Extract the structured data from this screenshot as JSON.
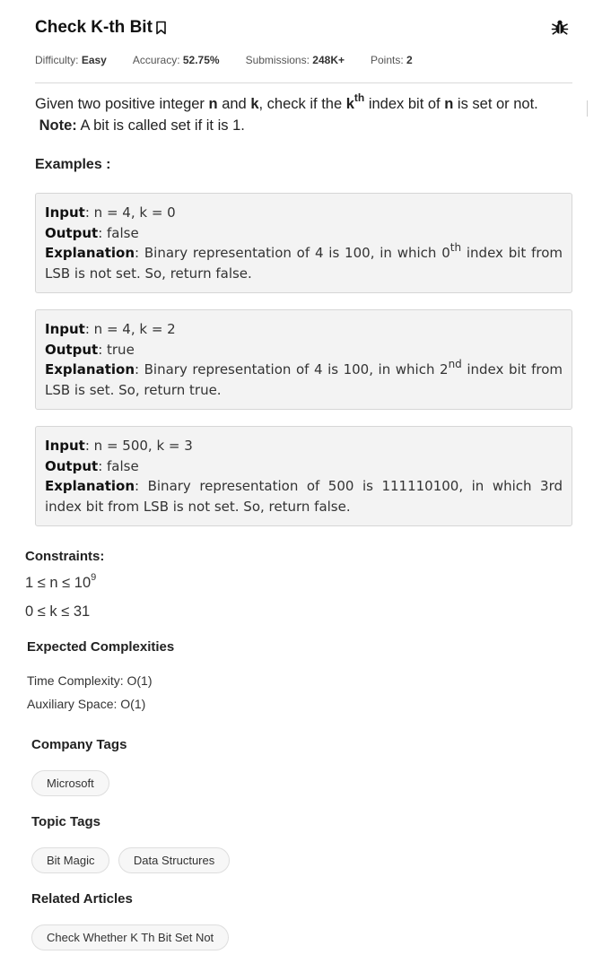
{
  "header": {
    "title": "Check K-th Bit",
    "difficulty_label": "Difficulty:",
    "difficulty": "Easy",
    "accuracy_label": "Accuracy:",
    "accuracy": "52.75%",
    "submissions_label": "Submissions:",
    "submissions": "248K+",
    "points_label": "Points:",
    "points": "2"
  },
  "problem": {
    "p1": "Given two positive integer ",
    "n": "n",
    "p2": " and  ",
    "k": "k",
    "p3": ", check if the ",
    "kth_base": "k",
    "kth_sup": "th",
    "p4": " index bit of ",
    "n2": "n",
    "p5": " is set or not.",
    "note_label": "Note:",
    "note_text": " A bit is called set if it is 1."
  },
  "examples_heading": "Examples :",
  "examples": [
    {
      "input_label": "Input",
      "input": ": n = 4, k = 0",
      "output_label": "Output",
      "output": ": false",
      "explanation_label": "Explanation",
      "exp_a": ": Binary representation of 4 is 100, in which 0",
      "exp_sup": "th",
      "exp_b": " index bit from LSB is not set. So, return false."
    },
    {
      "input_label": "Input",
      "input": ": n = 4, k = 2",
      "output_label": "Output",
      "output": ": true",
      "explanation_label": "Explanation",
      "exp_a": ": Binary representation of 4 is 100, in which 2",
      "exp_sup": "nd",
      "exp_b": " index bit from LSB is set. So, return true."
    },
    {
      "input_label": "Input",
      "input": ": n = 500, k = 3",
      "output_label": "Output",
      "output": ": false",
      "explanation_label": "Explanation",
      "exp_a": ": Binary representation of 500 is 111110100, in which 3rd index bit from LSB is not set. So, return false."
    }
  ],
  "constraints": {
    "heading": "Constraints:",
    "c1_base": "1 ≤ n ≤ 10",
    "c1_sup": "9",
    "c2": "0 ≤ k ≤ 31"
  },
  "complexities": {
    "heading": "Expected Complexities",
    "time": "Time Complexity: O(1)",
    "space": "Auxiliary Space: O(1)"
  },
  "company_tags": {
    "heading": "Company Tags",
    "tags": [
      "Microsoft"
    ]
  },
  "topic_tags": {
    "heading": "Topic Tags",
    "tags": [
      "Bit Magic",
      "Data Structures"
    ]
  },
  "related_articles": {
    "heading": "Related Articles",
    "items": [
      "Check Whether K Th Bit Set Not"
    ]
  },
  "icons": {
    "bookmark": "bookmark-icon",
    "bug": "bug-icon"
  }
}
